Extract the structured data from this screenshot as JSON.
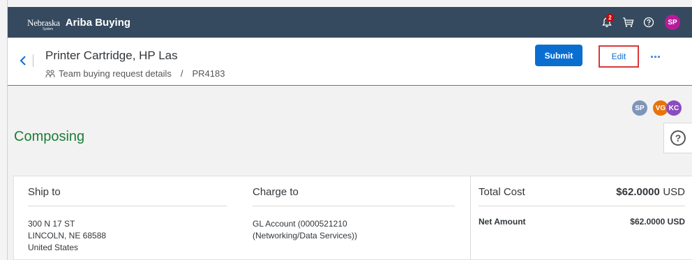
{
  "shell": {
    "logo_text": "Nebraska",
    "logo_sub": "System",
    "app_title": "Ariba Buying",
    "notification_count": "2",
    "user_initials": "SP"
  },
  "header": {
    "title": "Printer Cartridge, HP Las",
    "breadcrumb_item": "Team buying request details",
    "breadcrumb_sep": "/",
    "request_id": "PR4183",
    "submit_label": "Submit",
    "edit_label": "Edit"
  },
  "participants": [
    {
      "initials": "SP",
      "color": "#7f95b8"
    },
    {
      "initials": "VG",
      "color": "#e8730c"
    },
    {
      "initials": "KC",
      "color": "#8a4cc0"
    }
  ],
  "status": "Composing",
  "summary": {
    "ship_to": {
      "title": "Ship to",
      "line1": "300 N 17 ST",
      "line2": "LINCOLN, NE  68588",
      "line3": "United States"
    },
    "charge_to": {
      "title": "Charge to",
      "text": "GL Account (0000521210 (Networking/Data Services))"
    },
    "total": {
      "title": "Total Cost",
      "amount": "$62.0000",
      "currency": "USD",
      "net_label": "Net Amount",
      "net_value": "$62.0000 USD"
    }
  },
  "colors": {
    "shellbar": "#354a5f",
    "primary": "#0a6ed1",
    "status_green": "#1d7d36",
    "highlight_red": "#d9383a"
  }
}
